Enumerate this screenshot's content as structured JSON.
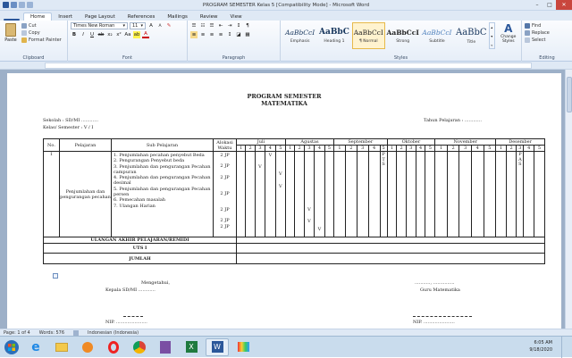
{
  "window": {
    "title": "PROGRAM SEMESTER Kelas 5 [Compatibility Mode] - Microsoft Word",
    "minimize": "–",
    "maximize": "□",
    "close": "✕"
  },
  "tabs": [
    "Home",
    "Insert",
    "Page Layout",
    "References",
    "Mailings",
    "Review",
    "View"
  ],
  "ribbon": {
    "clipboard": {
      "paste": "Paste",
      "cut": "Cut",
      "copy": "Copy",
      "format_painter": "Format Painter",
      "label": "Clipboard"
    },
    "font": {
      "name": "Times New Roman",
      "size": "11",
      "label": "Font"
    },
    "paragraph": {
      "label": "Paragraph"
    },
    "styles": {
      "label": "Styles",
      "items": [
        {
          "sample": "AaBbCcI",
          "name": "Emphasis"
        },
        {
          "sample": "AaBbC",
          "name": "Heading 1"
        },
        {
          "sample": "AaBbCcI",
          "name": "¶ Normal"
        },
        {
          "sample": "AaBbCcI",
          "name": "Strong"
        },
        {
          "sample": "AaBbCcI",
          "name": "Subtitle"
        },
        {
          "sample": "AaBbC",
          "name": "Title"
        }
      ],
      "change_styles": "Change Styles"
    },
    "editing": {
      "find": "Find",
      "replace": "Replace",
      "select": "Select",
      "label": "Editing"
    }
  },
  "document": {
    "title1": "PROGRAM SEMESTER",
    "title2": "MATEMATIKA",
    "sekolah": "Sekolah          : SD/MI ............",
    "kelas": "Kelas/ Semester       : V / I",
    "tahun": "Tahun Pelajaran      :  ............",
    "headers": {
      "no": "No.",
      "pelajaran": "Pelajaran",
      "sub": "Sub Pelajaran",
      "alokasi": "Alokasi Waktu"
    },
    "months": [
      "Juli",
      "Agustas",
      "September",
      "Oktober",
      "November",
      "Desember"
    ],
    "weeks": [
      "1",
      "2",
      "3",
      "4",
      "5"
    ],
    "row_no": "1",
    "pelajaran": "Penjumlahan dan pengurangan pecahan",
    "rows": [
      {
        "sub": "1.   Penjumlahan pecahan penyebut Beda",
        "alokasi": "2 JP"
      },
      {
        "sub": "2.   Pengurangan Penyebut beda",
        "alokasi": "2 JP"
      },
      {
        "sub": "3.   Penjumlahan dan pengurangan Pecahan campuran",
        "alokasi": "2 JP"
      },
      {
        "sub": "4.   Penjumlahan dan pengurangan Pecahan desimal",
        "alokasi": "2 JP"
      },
      {
        "sub": "5.   Penjumlahan dan pengurangan Pecahan persen",
        "alokasi": "2 JP"
      },
      {
        "sub": "6.   Pemecahan masalah",
        "alokasi": "2 JP"
      },
      {
        "sub": "7.   Ulangan Harian",
        "alokasi": "2 JP"
      }
    ],
    "marks": [
      "V",
      "V",
      "V",
      "V",
      "V",
      "V",
      "V"
    ],
    "pts": "P T S",
    "pas": "P A S",
    "remidi": "ULANGAN AKHIR PELAJARAN/REMIDI",
    "uts": "UTS  I",
    "jumlah": "JUMLAH",
    "mengetahui": "Mengetahui,",
    "kepala": "Kepala SD/MI ............",
    "tanggal": "..........., ...............",
    "guru": "Guru Matematika",
    "nip_left": "NIP. ......................",
    "nip_right": "NIP. ......................"
  },
  "status": {
    "page": "Page: 1 of 4",
    "words": "Words: 576",
    "language": "Indonesian (Indonesia)"
  },
  "clock": {
    "time": "6:05 AM",
    "date": "9/18/2020"
  }
}
